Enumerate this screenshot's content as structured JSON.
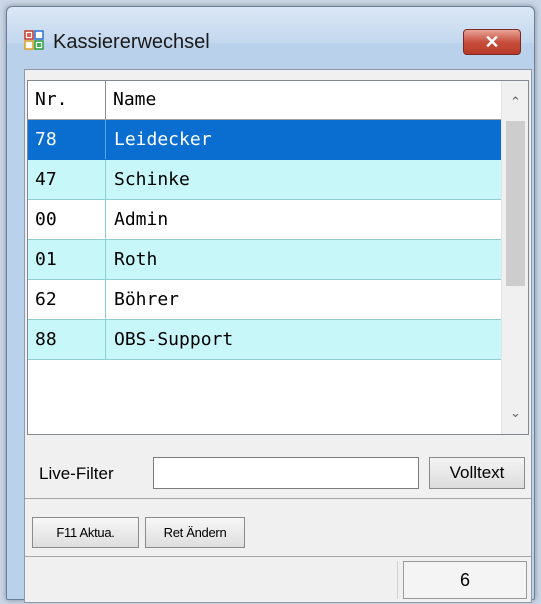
{
  "window": {
    "title": "Kassiererwechsel",
    "close_label": "✕",
    "icon": "app-grid-icon"
  },
  "grid": {
    "columns": [
      "Nr.",
      "Name"
    ],
    "rows": [
      {
        "nr": "78",
        "name": "Leidecker",
        "selected": true
      },
      {
        "nr": "47",
        "name": "Schinke"
      },
      {
        "nr": "00",
        "name": "Admin"
      },
      {
        "nr": "01",
        "name": "Roth"
      },
      {
        "nr": "62",
        "name": "Böhrer"
      },
      {
        "nr": "88",
        "name": "OBS-Support"
      }
    ],
    "scroll_up": "⌃",
    "scroll_down": "⌄"
  },
  "filter": {
    "label": "Live-Filter",
    "value": "",
    "button": "Volltext"
  },
  "actions": {
    "f11": "F11 Aktua.",
    "ret": "Ret Ändern"
  },
  "status": {
    "count": "6"
  },
  "colors": {
    "selected_row": "#0a6ed1",
    "alt_row": "#c7f7f8",
    "close_button": "#c74f3d"
  }
}
